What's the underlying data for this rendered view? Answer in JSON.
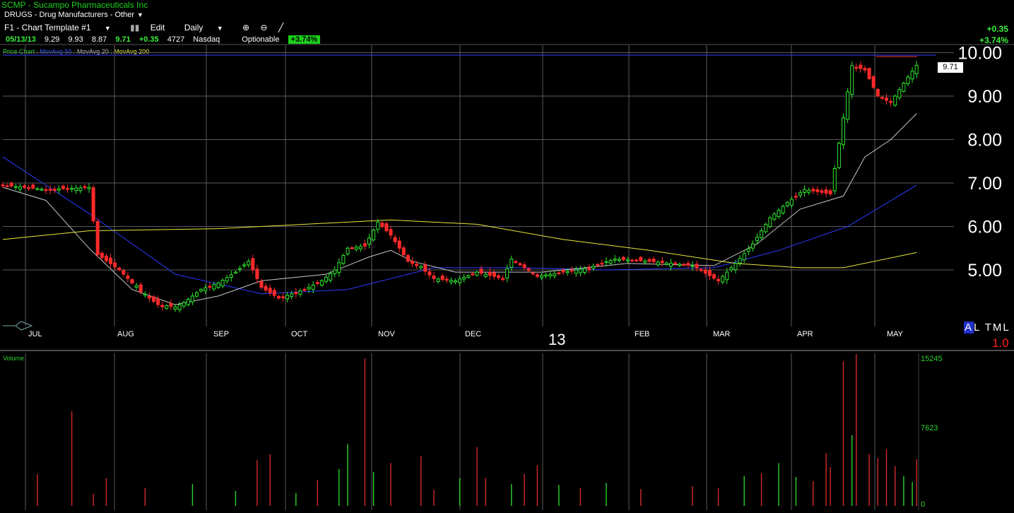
{
  "header": {
    "title": "SCMP - Sucampo Pharmaceuticals Inc",
    "group": "DRUGS - Drug Manufacturers - Other",
    "toolbar": {
      "template": "F1 - Chart Template #1",
      "edit": "Edit",
      "period": "Daily"
    }
  },
  "quote": {
    "date": "05/13/13",
    "open": "9.29",
    "high": "9.93",
    "low": "8.87",
    "last": "9.71",
    "change": "+0.35",
    "volume": "4727",
    "exchange": "Nasdaq",
    "optionable": "Optionable",
    "change_pct": "+3.74%"
  },
  "right_header": {
    "change": "+0.35",
    "change_pct": "+3.74%"
  },
  "legend": {
    "label": "Price Chart",
    "ma50": "MovAvg 50",
    "ma20": "MovAvg 20",
    "ma200": "MovAvg 200"
  },
  "overlay": {
    "last_price_box": "9.71",
    "altml": "AL TML",
    "scale": "1.0",
    "year_marker": "13"
  },
  "colors": {
    "up": "#2ee82e",
    "down": "#ff2a2a",
    "ma50": "#2a3cff",
    "ma20": "#c8c8c8",
    "ma200": "#e8e83b",
    "grid": "#5a5a5a",
    "price_axis": "#ffffff",
    "volume_axis": "#2fd12f"
  },
  "chart_data": [
    {
      "type": "candlestick",
      "title": "SCMP - Sucampo Pharmaceuticals Inc",
      "ylim": [
        4.0,
        10.2
      ],
      "yticks": [
        5.0,
        6.0,
        7.0,
        8.0,
        9.0,
        10.0
      ],
      "ytick_labels": [
        "5.00",
        "6.00",
        "7.00",
        "8.00",
        "9.00",
        "10.00"
      ],
      "month_labels": [
        "JUL",
        "AUG",
        "SEP",
        "OCT",
        "NOV",
        "DEC",
        "FEB",
        "MAR",
        "APR",
        "MAY"
      ],
      "close_path": [
        [
          0,
          6.95
        ],
        [
          10,
          6.85
        ],
        [
          20,
          6.9
        ],
        [
          22,
          5.35
        ],
        [
          27,
          5.0
        ],
        [
          32,
          4.5
        ],
        [
          36,
          4.2
        ],
        [
          40,
          4.15
        ],
        [
          42,
          4.25
        ],
        [
          46,
          4.55
        ],
        [
          50,
          4.7
        ],
        [
          54,
          4.95
        ],
        [
          57,
          5.2
        ],
        [
          60,
          4.6
        ],
        [
          64,
          4.35
        ],
        [
          70,
          4.55
        ],
        [
          74,
          4.75
        ],
        [
          77,
          5.0
        ],
        [
          80,
          5.5
        ],
        [
          84,
          5.55
        ],
        [
          87,
          6.1
        ],
        [
          90,
          5.8
        ],
        [
          94,
          5.2
        ],
        [
          97,
          5.05
        ],
        [
          100,
          4.8
        ],
        [
          105,
          4.75
        ],
        [
          110,
          4.95
        ],
        [
          116,
          4.8
        ],
        [
          118,
          5.25
        ],
        [
          124,
          4.85
        ],
        [
          130,
          4.95
        ],
        [
          136,
          5.05
        ],
        [
          142,
          5.25
        ],
        [
          150,
          5.2
        ],
        [
          160,
          5.1
        ],
        [
          166,
          4.75
        ],
        [
          170,
          5.15
        ],
        [
          174,
          5.6
        ],
        [
          178,
          6.2
        ],
        [
          182,
          6.55
        ],
        [
          186,
          6.85
        ],
        [
          192,
          6.75
        ],
        [
          195,
          8.5
        ],
        [
          197,
          9.7
        ],
        [
          200,
          9.6
        ],
        [
          203,
          9.0
        ],
        [
          206,
          8.85
        ],
        [
          209,
          9.3
        ],
        [
          212,
          9.71
        ]
      ],
      "moving_averages": [
        {
          "name": "MovAvg 50",
          "points": [
            [
              0,
              7.6
            ],
            [
              20,
              6.3
            ],
            [
              40,
              4.9
            ],
            [
              60,
              4.45
            ],
            [
              80,
              4.55
            ],
            [
              100,
              5.05
            ],
            [
              120,
              5.05
            ],
            [
              140,
              5.0
            ],
            [
              165,
              5.05
            ],
            [
              180,
              5.45
            ],
            [
              196,
              6.0
            ],
            [
              212,
              6.95
            ]
          ]
        },
        {
          "name": "MovAvg 20",
          "points": [
            [
              0,
              6.9
            ],
            [
              10,
              6.6
            ],
            [
              20,
              5.5
            ],
            [
              30,
              4.55
            ],
            [
              40,
              4.2
            ],
            [
              50,
              4.4
            ],
            [
              60,
              4.75
            ],
            [
              75,
              4.9
            ],
            [
              85,
              5.3
            ],
            [
              90,
              5.45
            ],
            [
              95,
              5.2
            ],
            [
              105,
              4.95
            ],
            [
              125,
              4.95
            ],
            [
              145,
              5.15
            ],
            [
              165,
              5.1
            ],
            [
              175,
              5.6
            ],
            [
              185,
              6.4
            ],
            [
              195,
              6.7
            ],
            [
              200,
              7.6
            ],
            [
              206,
              8.0
            ],
            [
              212,
              8.6
            ]
          ]
        },
        {
          "name": "MovAvg 200",
          "points": [
            [
              0,
              5.7
            ],
            [
              20,
              5.9
            ],
            [
              50,
              5.95
            ],
            [
              70,
              6.05
            ],
            [
              90,
              6.15
            ],
            [
              110,
              6.05
            ],
            [
              130,
              5.7
            ],
            [
              150,
              5.45
            ],
            [
              170,
              5.15
            ],
            [
              185,
              5.05
            ],
            [
              195,
              5.05
            ],
            [
              212,
              5.4
            ]
          ]
        }
      ]
    },
    {
      "type": "bar",
      "title": "Volume",
      "ylim": [
        0,
        15245
      ],
      "ytick_labels": [
        "15245",
        "7623",
        "0"
      ],
      "bars": [
        [
          8,
          3200
        ],
        [
          16,
          9500
        ],
        [
          21,
          1200
        ],
        [
          24,
          2800
        ],
        [
          33,
          1800
        ],
        [
          44,
          2200
        ],
        [
          54,
          1500
        ],
        [
          59,
          4600
        ],
        [
          62,
          5200
        ],
        [
          68,
          1300
        ],
        [
          73,
          2600
        ],
        [
          78,
          3700
        ],
        [
          80,
          6200
        ],
        [
          84,
          14800
        ],
        [
          86,
          3400
        ],
        [
          90,
          4300
        ],
        [
          97,
          5000
        ],
        [
          100,
          1600
        ],
        [
          106,
          2800
        ],
        [
          110,
          5900
        ],
        [
          112,
          2800
        ],
        [
          118,
          2200
        ],
        [
          121,
          3200
        ],
        [
          124,
          4100
        ],
        [
          129,
          2100
        ],
        [
          134,
          1800
        ],
        [
          140,
          2300
        ],
        [
          148,
          1700
        ],
        [
          160,
          2000
        ],
        [
          166,
          1800
        ],
        [
          172,
          3000
        ],
        [
          176,
          3300
        ],
        [
          180,
          4300
        ],
        [
          184,
          2900
        ],
        [
          188,
          2500
        ],
        [
          191,
          5300
        ],
        [
          192,
          3900
        ],
        [
          195,
          14500
        ],
        [
          197,
          7100
        ],
        [
          198,
          15245
        ],
        [
          201,
          5200
        ],
        [
          203,
          4800
        ],
        [
          205,
          5700
        ],
        [
          207,
          4000
        ],
        [
          209,
          3000
        ],
        [
          211,
          2400
        ],
        [
          212,
          4700
        ]
      ]
    }
  ]
}
